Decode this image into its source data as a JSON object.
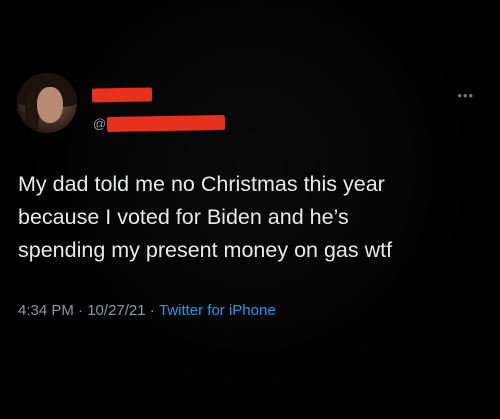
{
  "tweet": {
    "handle_prefix": "@",
    "more_label": "•••",
    "text": "My dad told me no Christmas this year\nbecause I voted for Biden and he’s\nspending my present money on gas wtf",
    "time": "4:34 PM",
    "separator": " · ",
    "date": "10/27/21",
    "source": "Twitter for iPhone"
  },
  "colors": {
    "background": "#000000",
    "text": "#e7e9ea",
    "secondary_text": "#8b98a5",
    "link": "#1d9bf0",
    "redaction": "#e8311c"
  },
  "icons": {
    "more": "more-dots-icon",
    "avatar": "profile-photo"
  }
}
